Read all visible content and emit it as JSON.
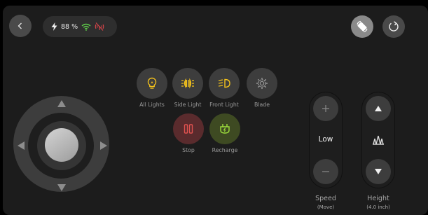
{
  "status": {
    "battery": "88 %"
  },
  "actions": [
    {
      "label": "All Lights"
    },
    {
      "label": "Side Light"
    },
    {
      "label": "Front Light"
    },
    {
      "label": "Blade"
    },
    {
      "label": "Stop"
    },
    {
      "label": "Recharge"
    }
  ],
  "speed": {
    "value": "Low",
    "title": "Speed",
    "subtitle": "(Move)"
  },
  "height": {
    "title": "Height",
    "subtitle": "(4.0 inch)"
  },
  "colors": {
    "accent_yellow": "#f4c21c",
    "stop_red": "#e0524f",
    "recharge_green": "#9edf3c",
    "wifi_green": "#5fd04a",
    "signal_red": "#d9454a"
  },
  "icons": [
    "back-icon",
    "bolt-icon",
    "wifi-icon",
    "no-signal-icon",
    "rotate-screen-icon",
    "refresh-icon",
    "bulb-icon",
    "side-light-icon",
    "front-light-icon",
    "blade-gear-icon",
    "stop-icon",
    "recharge-icon",
    "plus-icon",
    "minus-icon",
    "up-arrow-icon",
    "down-arrow-icon",
    "grass-icon"
  ]
}
